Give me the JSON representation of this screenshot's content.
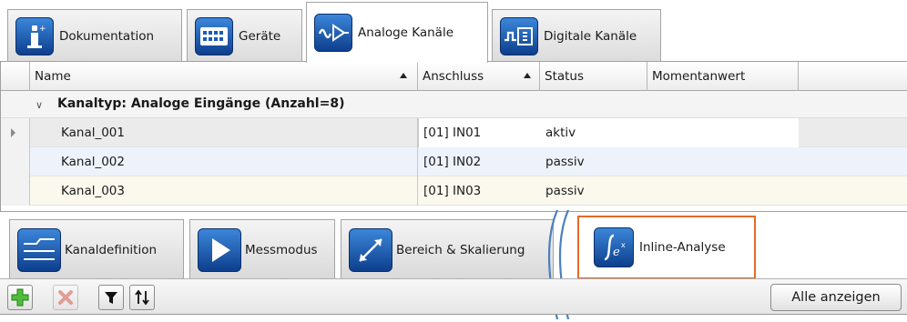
{
  "top_tabs": [
    {
      "label": "Dokumentation",
      "icon": "documentation-icon"
    },
    {
      "label": "Geräte",
      "icon": "device-icon"
    },
    {
      "label": "Analoge Kanäle",
      "icon": "analog-channel-icon",
      "active": true
    },
    {
      "label": "Digitale Kanäle",
      "icon": "digital-channel-icon"
    }
  ],
  "grid": {
    "columns": [
      {
        "label": "Name",
        "sort": "ascending"
      },
      {
        "label": "Anschluss",
        "sort": "ascending"
      },
      {
        "label": "Status"
      },
      {
        "label": "Momentanwert"
      }
    ],
    "group_label": "Kanaltyp: Analoge Eingänge (Anzahl=8)",
    "rows": [
      {
        "name": "Kanal_001",
        "anschluss": "[01] IN01",
        "status": "aktiv",
        "momentanwert": ""
      },
      {
        "name": "Kanal_002",
        "anschluss": "[01] IN02",
        "status": "passiv",
        "momentanwert": ""
      },
      {
        "name": "Kanal_003",
        "anschluss": "[01] IN03",
        "status": "passiv",
        "momentanwert": ""
      }
    ]
  },
  "bottom_tabs": [
    {
      "label": "Kanaldefinition",
      "icon": "channel-definition-icon"
    },
    {
      "label": "Messmodus",
      "icon": "play-icon"
    },
    {
      "label": "Bereich & Skalierung",
      "icon": "range-scaling-icon"
    },
    {
      "label": "Inline-Analyse",
      "icon": "function-icon",
      "highlighted": true
    }
  ],
  "toolbar": {
    "add_icon": "plus-icon",
    "delete_icon": "delete-icon",
    "filter_icon": "filter-icon",
    "sort_icon": "sort-icon",
    "show_all_label": "Alle anzeigen"
  },
  "colors": {
    "icon_blue": "#1a5bb5",
    "highlight_border": "#e36a2a",
    "row_selected": "#ebebeb",
    "row_alt_blue": "#eef3fb",
    "row_alt_cream": "#fbf9ee"
  }
}
